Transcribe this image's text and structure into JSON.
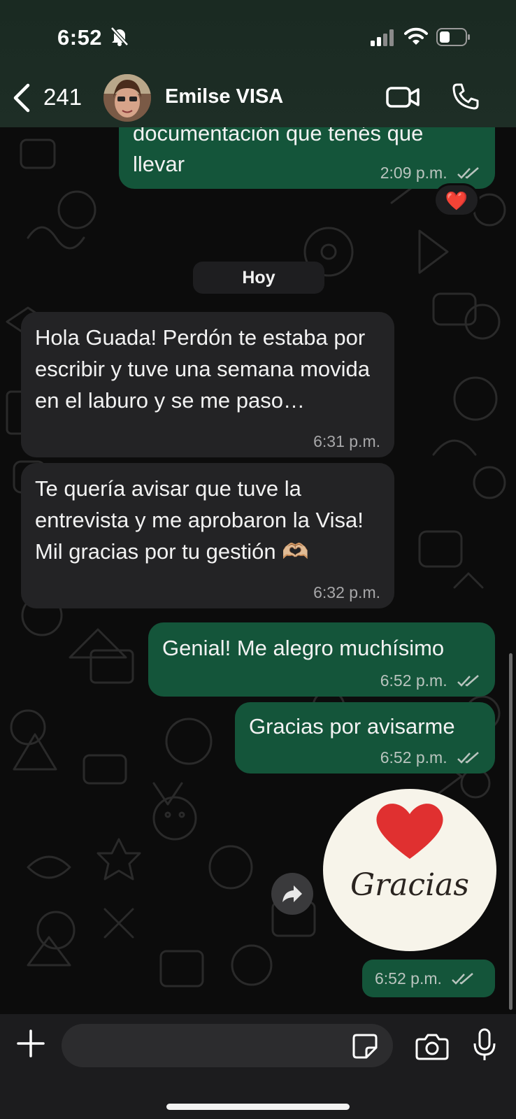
{
  "status_bar": {
    "time": "6:52"
  },
  "header": {
    "back_count": "241",
    "contact_name": "Emilse VISA"
  },
  "messages": [
    {
      "type": "out",
      "text_line1": "documentación que tenés que",
      "text_line2": "llevar",
      "time": "2:09 p.m.",
      "reaction": "❤️"
    },
    {
      "type": "day",
      "text": "Hoy"
    },
    {
      "type": "in",
      "text": "Hola Guada! Perdón te estaba por escribir y tuve una semana movida en el laburo y se me paso…",
      "time": "6:31 p.m."
    },
    {
      "type": "in",
      "text": "Te quería avisar que tuve la entrevista y me aprobaron la Visa! Mil gracias por tu gestión 🫶🏼",
      "time": "6:32 p.m."
    },
    {
      "type": "out",
      "text": "Genial! Me alegro muchísimo",
      "time": "6:52 p.m."
    },
    {
      "type": "out",
      "text": "Gracias por avisarme",
      "time": "6:52 p.m."
    },
    {
      "type": "sticker",
      "text": "Gracias",
      "time": "6:52 p.m."
    }
  ],
  "input": {
    "placeholder": ""
  },
  "colors": {
    "incoming_bubble": "#232325",
    "outgoing_bubble": "#14553a",
    "header_bg": "#1c2c24",
    "sticker_heart": "#e03030"
  },
  "icons": [
    "bell-slash-icon",
    "signal-icon",
    "wifi-icon",
    "battery-icon",
    "back-chevron-icon",
    "video-call-icon",
    "phone-call-icon",
    "forward-icon",
    "plus-icon",
    "sticker-icon",
    "camera-icon",
    "microphone-icon",
    "double-check-icon"
  ]
}
